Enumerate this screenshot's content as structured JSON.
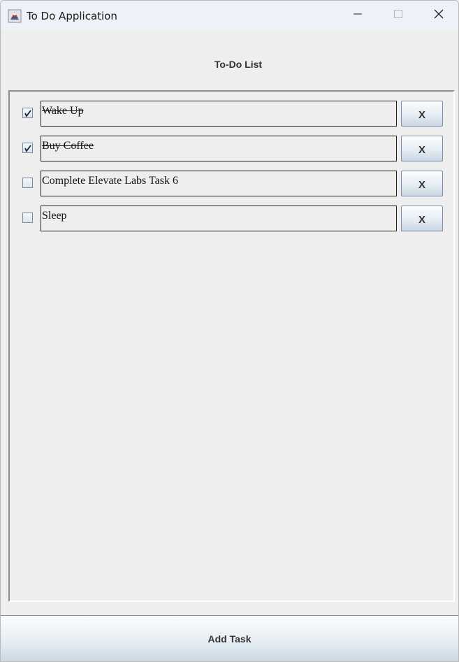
{
  "window": {
    "title": "To Do Application",
    "controls": {
      "minimize_icon": "minimize-icon",
      "maximize_icon": "maximize-icon",
      "close_icon": "close-icon"
    }
  },
  "heading": "To-Do List",
  "tasks": [
    {
      "text": "Wake Up ",
      "checked": true,
      "delete_label": "X"
    },
    {
      "text": "Buy Coffee ",
      "checked": true,
      "delete_label": "X"
    },
    {
      "text": "Complete Elevate Labs Task 6",
      "checked": false,
      "delete_label": "X"
    },
    {
      "text": "Sleep",
      "checked": false,
      "delete_label": "X"
    }
  ],
  "add_button_label": "Add Task",
  "colors": {
    "background": "#eeeeee",
    "titlebar": "#eef1f7",
    "button_border": "#7a8ea8"
  }
}
